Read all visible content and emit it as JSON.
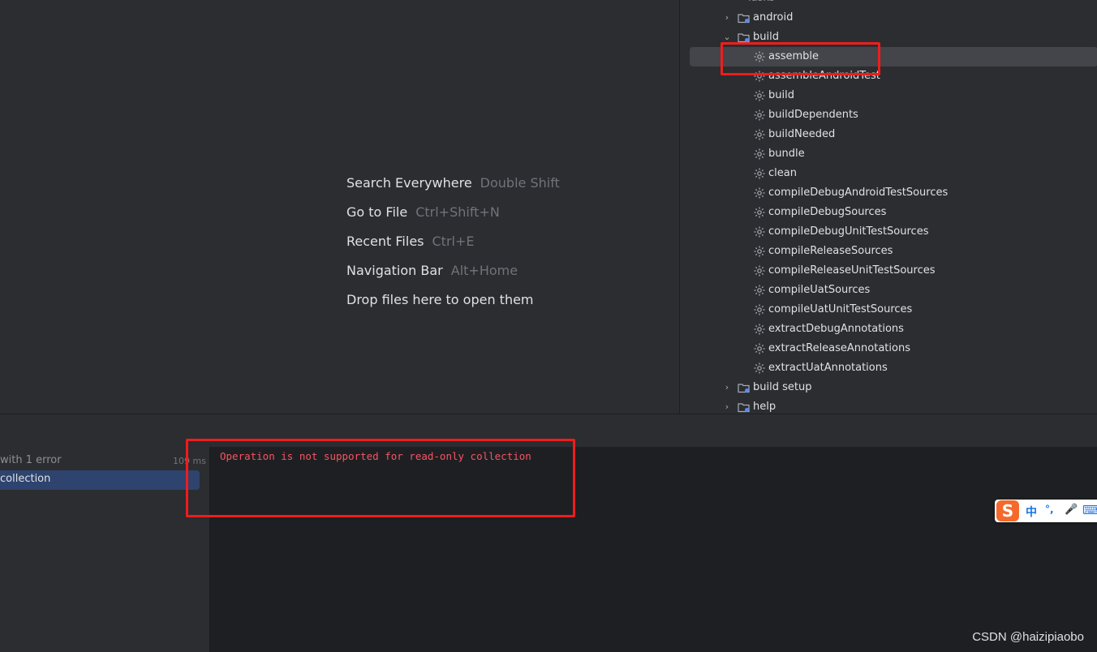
{
  "editor": {
    "hints": [
      {
        "label": "Search Everywhere",
        "key": "Double Shift"
      },
      {
        "label": "Go to File",
        "key": "Ctrl+Shift+N"
      },
      {
        "label": "Recent Files",
        "key": "Ctrl+E"
      },
      {
        "label": "Navigation Bar",
        "key": "Alt+Home"
      },
      {
        "label": "Drop files here to open them",
        "key": ""
      }
    ]
  },
  "gradle_tree": {
    "top_partial": "Tasks",
    "groups": [
      {
        "label": "android",
        "expanded": false
      },
      {
        "label": "build",
        "expanded": true
      }
    ],
    "build_tasks": [
      "assemble",
      "assembleAndroidTest",
      "build",
      "buildDependents",
      "buildNeeded",
      "bundle",
      "clean",
      "compileDebugAndroidTestSources",
      "compileDebugSources",
      "compileDebugUnitTestSources",
      "compileReleaseSources",
      "compileReleaseUnitTestSources",
      "compileUatSources",
      "compileUatUnitTestSources",
      "extractDebugAnnotations",
      "extractReleaseAnnotations",
      "extractUatAnnotations"
    ],
    "selected_task": "assemble",
    "trailing_groups": [
      {
        "label": "build setup",
        "expanded": false
      },
      {
        "label": "help",
        "expanded": false
      }
    ]
  },
  "build_output": {
    "summary": "with 1 error",
    "time": "109 ms",
    "selected_item": "collection",
    "error_message": "Operation is not supported for read-only collection"
  },
  "ime": {
    "lang": "中",
    "punct": "°,",
    "mic": "🎤",
    "kbd": "⌨"
  },
  "watermark": "CSDN @haizipiaobo",
  "colors": {
    "highlight_box": "#f01c1c",
    "error_text": "#f75464",
    "selection": "#2e436e"
  }
}
